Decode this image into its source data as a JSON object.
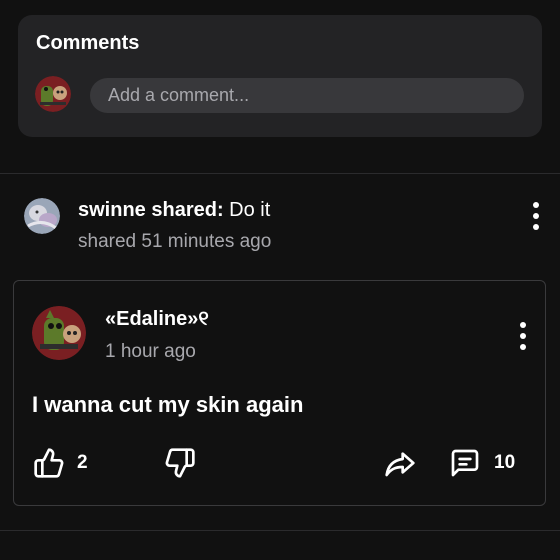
{
  "comments_section": {
    "title": "Comments",
    "input_placeholder": "Add a comment..."
  },
  "shared_post": {
    "sharer": "swinne",
    "shared_label": " shared:",
    "share_caption": " Do it",
    "shared_time": "shared 51 minutes ago"
  },
  "original_post": {
    "author": "«Edaline»୧",
    "time": "1 hour ago",
    "text": "I wanna cut my skin again",
    "likes": "2",
    "comments": "10"
  },
  "icons": {
    "kebab": "more-vertical-icon",
    "like": "thumbs-up-icon",
    "dislike": "thumbs-down-icon",
    "share": "share-arrow-icon",
    "comment": "comment-bubble-icon"
  },
  "colors": {
    "background": "#111111",
    "card": "#232325",
    "input": "#38383b",
    "muted_text": "#a8a8ad",
    "border": "#3a3a3c"
  }
}
